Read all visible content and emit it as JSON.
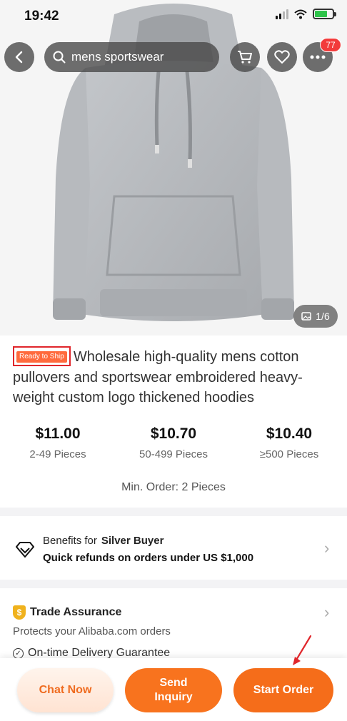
{
  "status_bar": {
    "time": "19:42"
  },
  "nav": {
    "search_query": "mens sportswear",
    "badge_count": "77"
  },
  "image": {
    "counter": "1/6"
  },
  "product": {
    "tag": "Ready to Ship",
    "title": "Wholesale high-quality mens cotton pullovers and sportswear embroidered heavy-weight custom logo thickened hoodies"
  },
  "prices": [
    {
      "price": "$11.00",
      "qty": "2-49 Pieces"
    },
    {
      "price": "$10.70",
      "qty": "50-499 Pieces"
    },
    {
      "price": "$10.40",
      "qty": "≥500 Pieces"
    }
  ],
  "min_order": "Min. Order: 2 Pieces",
  "benefits": {
    "prefix": "Benefits for",
    "tier": "Silver Buyer",
    "detail": "Quick refunds on orders under US $1,000"
  },
  "trade_assurance": {
    "title": "Trade Assurance",
    "subtitle": "Protects your Alibaba.com orders",
    "item": "On-time Delivery Guarantee"
  },
  "actions": {
    "chat": "Chat Now",
    "inquiry_line1": "Send",
    "inquiry_line2": "Inquiry",
    "order": "Start Order"
  },
  "colors": {
    "accent": "#f56d1a",
    "badge": "#f23b3b",
    "tag": "#ff6a3d",
    "highlight_box": "#e0262b"
  }
}
